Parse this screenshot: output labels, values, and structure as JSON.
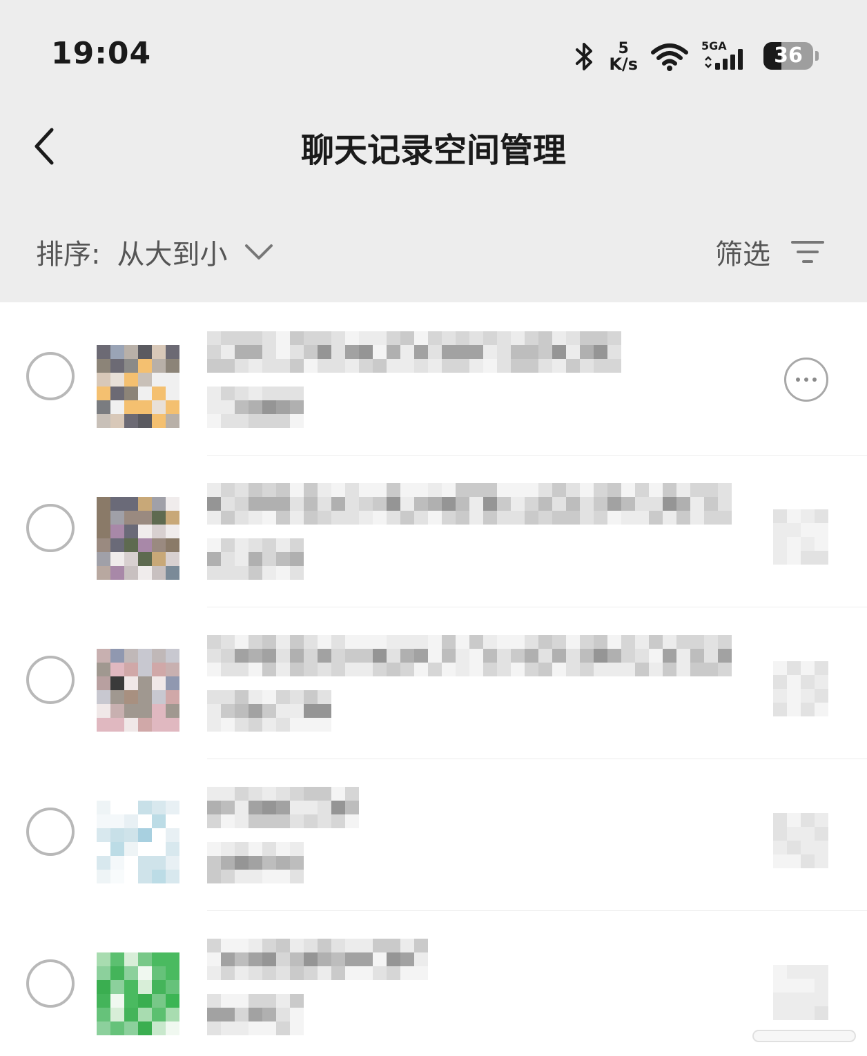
{
  "status_bar": {
    "time": "19:04",
    "net_speed_value": "5",
    "net_speed_unit": "K/s",
    "network_type": "5GA",
    "battery_level": "36",
    "battery_percent": 36,
    "icons": [
      "bluetooth-icon",
      "wifi-icon",
      "signal-icon",
      "battery-icon"
    ]
  },
  "header": {
    "title": "聊天记录空间管理",
    "back_icon": "chevron-left-icon"
  },
  "toolbar": {
    "sort_label": "排序:",
    "sort_value": "从大到小",
    "sort_icon": "chevron-down-icon",
    "filter_label": "筛选",
    "filter_icon": "filter-icon"
  },
  "list": {
    "items": [
      {
        "avatar": "group-avatar",
        "name_text": "",
        "size_text": "",
        "action_icon": "more-icon"
      },
      {
        "avatar": "group-avatar",
        "name_text": "",
        "size_text": "",
        "action_icon": "more-icon"
      },
      {
        "avatar": "group-avatar",
        "name_text": "",
        "size_text": "",
        "action_icon": "more-icon"
      },
      {
        "avatar": "contact-avatar",
        "name_text": "",
        "size_text": "",
        "action_icon": "more-icon"
      },
      {
        "avatar": "file-transfer-avatar",
        "name_text": "",
        "size_text": "",
        "action_icon": "more-icon"
      }
    ]
  },
  "colors": {
    "header_bg": "#ededed",
    "list_bg": "#ffffff",
    "text_primary": "#1a1a1a",
    "text_secondary": "#555555",
    "radio_border": "#b8b8b8",
    "accent_green": "#3cb554"
  }
}
